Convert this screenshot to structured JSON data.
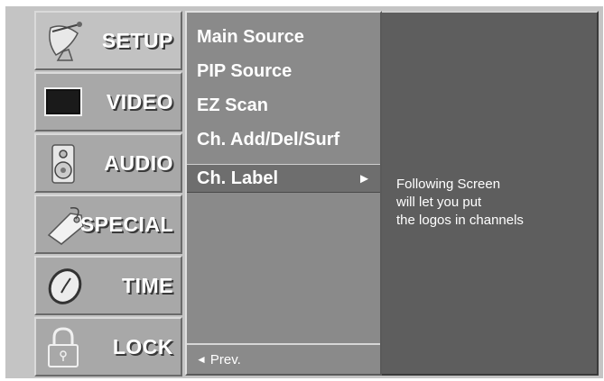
{
  "tabs": [
    {
      "label": "SETUP",
      "icon": "satellite-dish-icon",
      "active": true
    },
    {
      "label": "VIDEO",
      "icon": "screen-icon",
      "active": false
    },
    {
      "label": "AUDIO",
      "icon": "speaker-icon",
      "active": false
    },
    {
      "label": "SPECIAL",
      "icon": "tag-icon",
      "active": false
    },
    {
      "label": "TIME",
      "icon": "clock-icon",
      "active": false
    },
    {
      "label": "LOCK",
      "icon": "padlock-icon",
      "active": false
    }
  ],
  "menu": {
    "items": [
      {
        "label": "Main Source"
      },
      {
        "label": "PIP Source"
      },
      {
        "label": "EZ Scan"
      },
      {
        "label": "Ch. Add/Del/Surf"
      },
      {
        "label": "Ch. Label",
        "arrow": "►"
      }
    ],
    "prev_arrow": "◄",
    "prev_label": "Prev."
  },
  "description": {
    "lines": [
      "Following Screen",
      "will let you put",
      "the logos in channels"
    ]
  },
  "colors": {
    "background": "#c4c4c4",
    "tab": "#a8a8a8",
    "menu_panel": "#8a8a8a",
    "selected_item": "#6e6e6e",
    "description_panel": "#5e5e5e",
    "text": "#ffffff"
  }
}
